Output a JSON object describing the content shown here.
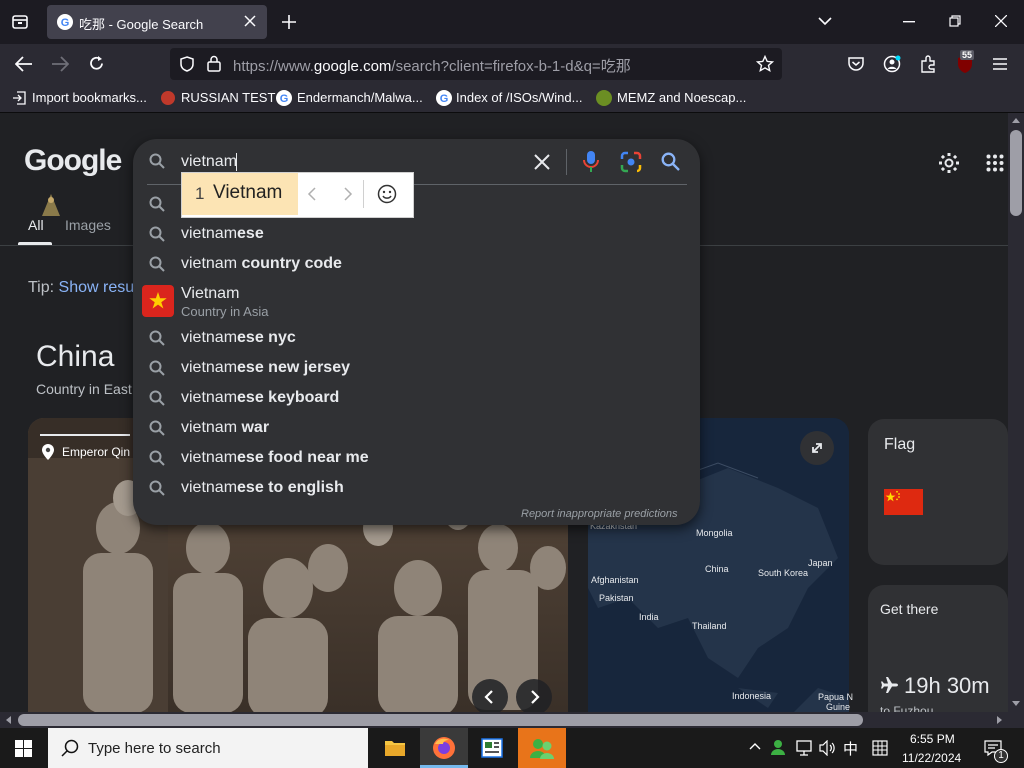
{
  "browser": {
    "tab_title": "吃那 - Google Search",
    "url_prefix": "https://www.",
    "url_domain": "google.com",
    "url_rest": "/search?client=firefox-b-1-d&q=吃那",
    "bookmarks": [
      "Import bookmarks...",
      "RUSSIAN TEST",
      "Endermanch/Malwa...",
      "Index of /ISOs/Wind...",
      "MEMZ and Noescap..."
    ],
    "notification_count": "55"
  },
  "google": {
    "logo": "Google",
    "tabs": [
      "All",
      "Images"
    ],
    "tip_prefix": "Tip:",
    "tip_link": "Show resu",
    "entity_title": "China",
    "entity_subtitle": "Country in East",
    "photo_caption": "Emperor Qin",
    "flag_card_title": "Flag",
    "get_there_title": "Get there",
    "travel_time": "19h 30m",
    "travel_dest": "to Fuzhou"
  },
  "search": {
    "query": "vietnam",
    "ime_candidate_index": "1",
    "ime_candidate": "Vietnam",
    "report_link": "Report inappropriate predictions",
    "suggestions": [
      {
        "prefix": "vietnam",
        "bold": "ese"
      },
      {
        "prefix": "vietnam",
        "bold": " country code"
      },
      {
        "title": "Vietnam",
        "subtitle": "Country in Asia"
      },
      {
        "prefix": "vietnam",
        "bold": "ese nyc"
      },
      {
        "prefix": "vietnam",
        "bold": "ese new jersey"
      },
      {
        "prefix": "vietnam",
        "bold": "ese keyboard"
      },
      {
        "prefix": "vietnam",
        "bold": " war"
      },
      {
        "prefix": "vietnam",
        "bold": "ese food near me"
      },
      {
        "prefix": "vietnam",
        "bold": "ese to english"
      }
    ]
  },
  "map_labels": [
    "Kazakhstan",
    "Mongolia",
    "Afghanistan",
    "Pakistan",
    "China",
    "South Korea",
    "Japan",
    "India",
    "Thailand",
    "Indonesia",
    "Papua N",
    "Guine"
  ],
  "taskbar": {
    "search_placeholder": "Type here to search",
    "time": "6:55 PM",
    "date": "11/22/2024",
    "ime_indicator": "中",
    "notification_badge": "1"
  },
  "colors": {
    "google_blue": "#4285f4",
    "google_red": "#ea4335",
    "google_yellow": "#fbbc05",
    "google_green": "#34a853",
    "link_blue": "#8ab4f8",
    "page_bg": "#202124",
    "dropdown_bg": "#303134"
  }
}
